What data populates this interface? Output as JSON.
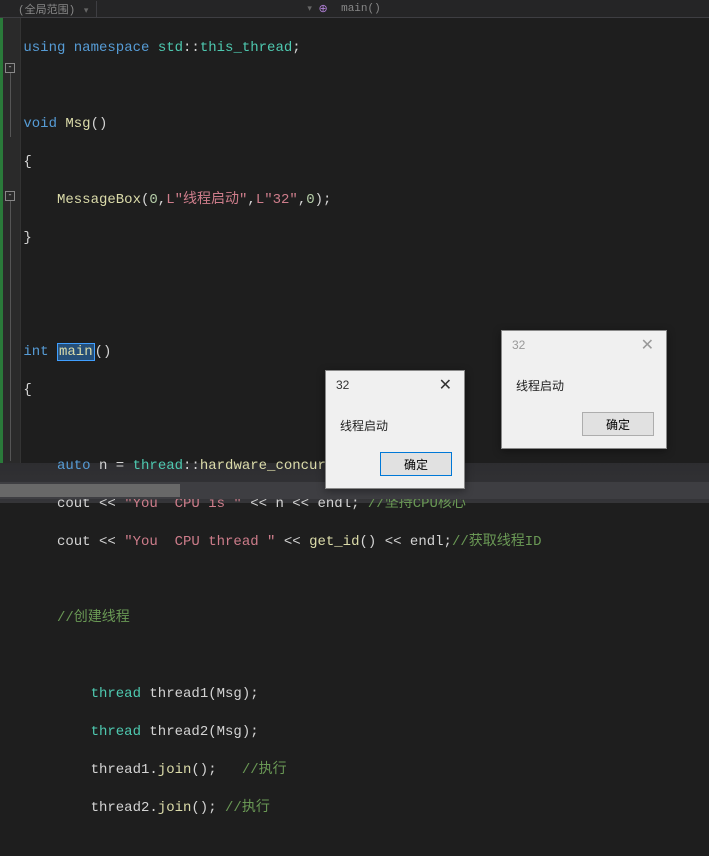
{
  "topbar": {
    "scope_label": "(全局范围)",
    "function_label": "main()"
  },
  "code": {
    "l1_using": "using",
    "l1_namespace": "namespace",
    "l1_ns1": "std",
    "l1_ns2": "this_thread",
    "l3_void": "void",
    "l3_fn": "Msg",
    "l5_fn": "MessageBox",
    "l5_arg0": "0",
    "l5_str1": "L\"线程启动\"",
    "l5_str2": "L\"32\"",
    "l5_arg3": "0",
    "l9_int": "int",
    "l9_main": "main",
    "l12_auto": "auto",
    "l12_n": "n",
    "l12_thread": "thread",
    "l12_fn": "hardware_concurrency",
    "l13_cout": "cout",
    "l13_str": "\"You  CPU is \"",
    "l13_n": "n",
    "l13_endl": "endl",
    "l13_cmt": "//坚持CPU核心",
    "l14_cout": "cout",
    "l14_str": "\"You  CPU thread \"",
    "l14_fn": "get_id",
    "l14_endl": "endl",
    "l14_cmt": "//获取线程ID",
    "l16_cmt": "//创建线程",
    "l18_thread": "thread",
    "l18_var": "thread1",
    "l18_arg": "Msg",
    "l19_thread": "thread",
    "l19_var": "thread2",
    "l19_arg": "Msg",
    "l20_var": "thread1",
    "l20_fn": "join",
    "l20_cmt": "//执行",
    "l21_var": "thread2",
    "l21_fn": "join",
    "l21_cmt": "//执行"
  },
  "dialog1": {
    "title": "32",
    "message": "线程启动",
    "ok": "确定"
  },
  "dialog2": {
    "title": "32",
    "message": "线程启动",
    "ok": "确定"
  }
}
